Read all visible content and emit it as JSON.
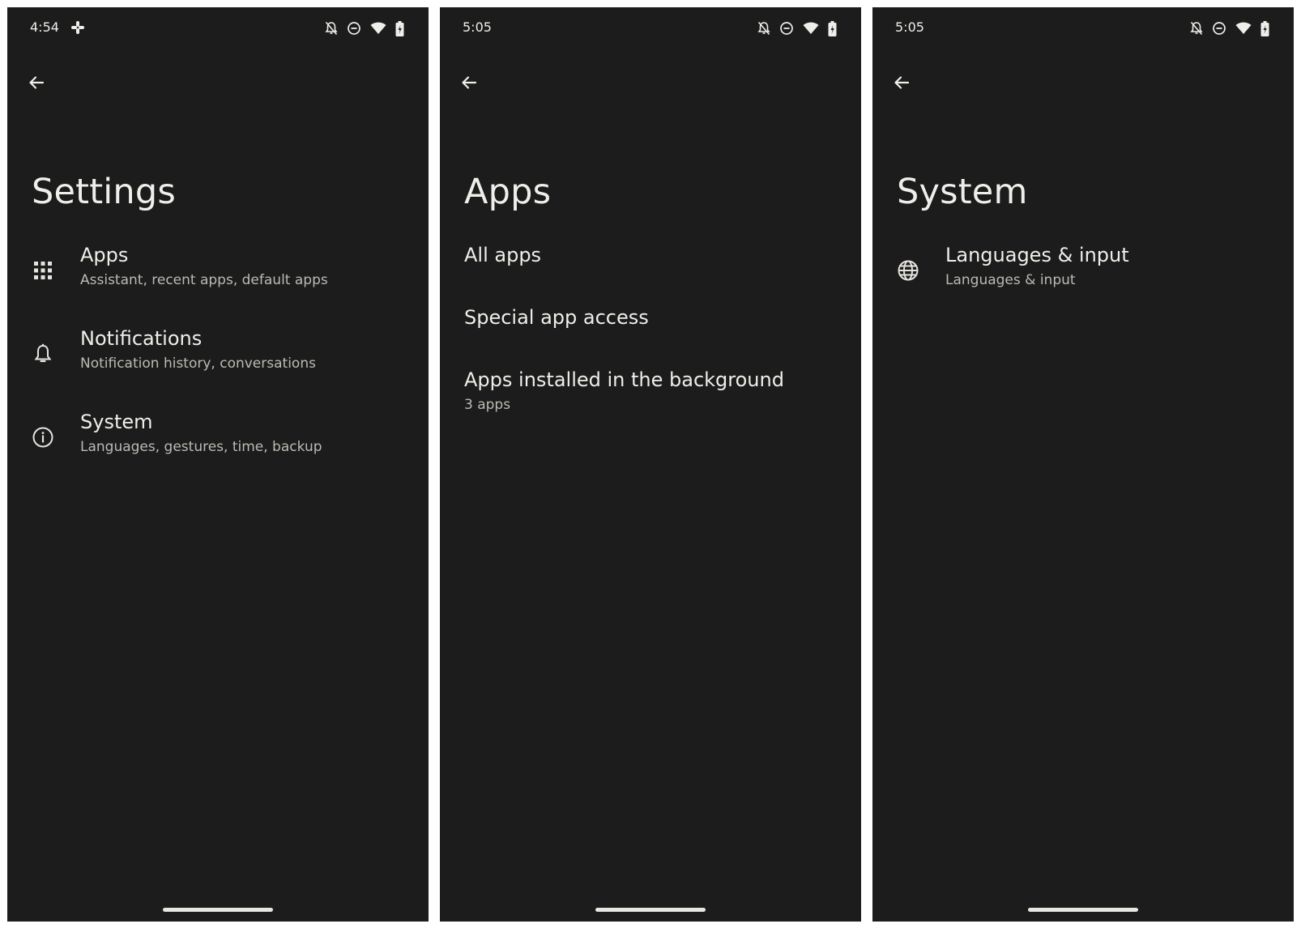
{
  "screens": [
    {
      "status": {
        "time": "4:54"
      },
      "title": "Settings",
      "items": [
        {
          "icon": "apps-grid-icon",
          "title": "Apps",
          "subtitle": "Assistant, recent apps, default apps"
        },
        {
          "icon": "bell-icon",
          "title": "Notifications",
          "subtitle": "Notification history, conversations"
        },
        {
          "icon": "info-icon",
          "title": "System",
          "subtitle": "Languages, gestures, time, backup"
        }
      ]
    },
    {
      "status": {
        "time": "5:05"
      },
      "title": "Apps",
      "items": [
        {
          "title": "All apps"
        },
        {
          "title": "Special app access"
        },
        {
          "title": "Apps installed in the background",
          "subtitle": "3 apps"
        }
      ]
    },
    {
      "status": {
        "time": "5:05"
      },
      "title": "System",
      "items": [
        {
          "icon": "globe-icon",
          "title": "Languages & input",
          "subtitle": "Languages & input"
        }
      ]
    }
  ],
  "colors": {
    "background": "#1b1c1b",
    "primary_text": "#f0eeea",
    "secondary_text": "#bdbab5"
  }
}
